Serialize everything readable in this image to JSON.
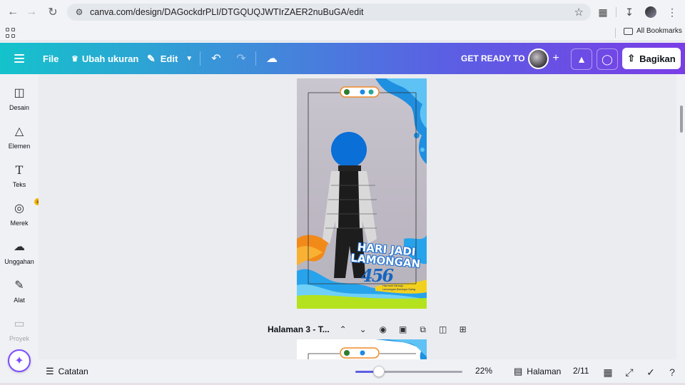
{
  "browser": {
    "url": "canva.com/design/DAGockdrPLI/DTGQUQJWTIrZAER2nuBuGA/edit",
    "bookmarks_label": "All Bookmarks"
  },
  "toolbar": {
    "file_label": "File",
    "resize_label": "Ubah ukuran",
    "edit_label": "Edit",
    "project_title": "GET READY TO",
    "share_label": "Bagikan"
  },
  "sidebar": {
    "items": [
      {
        "label": "Desain",
        "icon": "layout-icon"
      },
      {
        "label": "Elemen",
        "icon": "shapes-icon"
      },
      {
        "label": "Teks",
        "icon": "text-icon"
      },
      {
        "label": "Merek",
        "icon": "brand-icon"
      },
      {
        "label": "Unggahan",
        "icon": "upload-icon"
      },
      {
        "label": "Alat",
        "icon": "draw-icon"
      },
      {
        "label": "Proyek",
        "icon": "folder-icon"
      }
    ]
  },
  "design": {
    "headline_line1": "HARI JADI",
    "headline_line2": "LAMONGAN",
    "anniversary_number": "456",
    "tagline_line1": "Harmoni Menuju",
    "tagline_line2": "Lamongan Berdaya Saing"
  },
  "page_label": {
    "title": "Halaman 3 - T..."
  },
  "bottom": {
    "notes_label": "Catatan",
    "zoom_value": "22%",
    "zoom_fraction": 0.22,
    "pages_label": "Halaman",
    "page_counter": "2/11"
  },
  "colors": {
    "toolbar_start": "#14c3cc",
    "toolbar_end": "#7a3ee6",
    "accent": "#7c4dff"
  }
}
